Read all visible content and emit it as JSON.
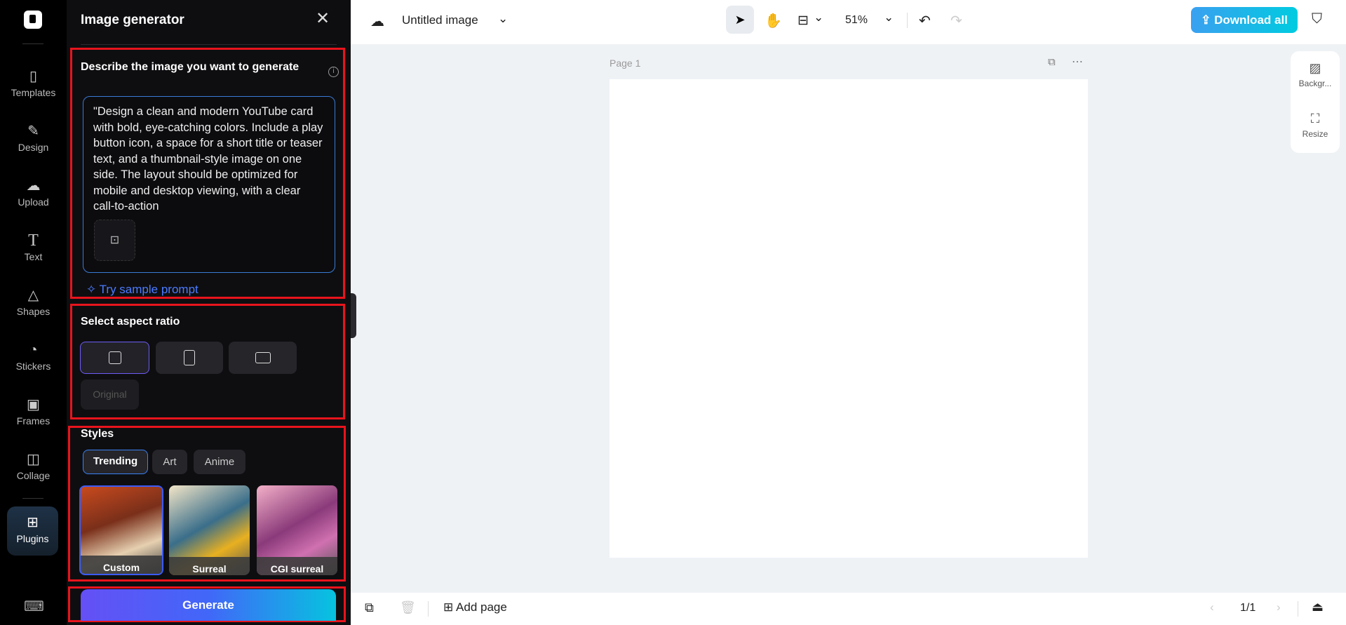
{
  "nav": {
    "items": [
      {
        "label": "Templates",
        "icon": "templates-icon"
      },
      {
        "label": "Design",
        "icon": "design-icon"
      },
      {
        "label": "Upload",
        "icon": "upload-cloud-icon"
      },
      {
        "label": "Text",
        "icon": "text-icon"
      },
      {
        "label": "Shapes",
        "icon": "shapes-icon"
      },
      {
        "label": "Stickers",
        "icon": "sticker-icon"
      },
      {
        "label": "Frames",
        "icon": "frame-icon"
      },
      {
        "label": "Collage",
        "icon": "collage-icon"
      }
    ],
    "plugins": "Plugins"
  },
  "panel": {
    "title": "Image generator",
    "prompt_heading": "Describe the image you want to generate",
    "prompt_value": "\"Design a clean and modern YouTube card with bold, eye-catching colors. Include a play button icon, a space for a short title or teaser text, and a thumbnail-style image on one side. The layout should be optimized for mobile and desktop viewing, with a clear call-to-action",
    "sample_prompt": "Try sample prompt",
    "aspect_heading": "Select aspect ratio",
    "aspect_original": "Original",
    "styles_heading": "Styles",
    "style_tabs": [
      "Trending",
      "Art",
      "Anime"
    ],
    "style_cards": [
      "Custom",
      "Surreal",
      "CGI surreal"
    ],
    "generate": "Generate"
  },
  "top": {
    "title": "Untitled image",
    "zoom": "51%",
    "download": "Download all"
  },
  "canvas": {
    "page_label": "Page 1"
  },
  "right_panel": {
    "background": "Backgr...",
    "resize": "Resize"
  },
  "bottom": {
    "add_page": "Add page",
    "page_counter": "1/1"
  },
  "colors": {
    "accent": "#3b82f6",
    "annotation": "#e8141c"
  }
}
